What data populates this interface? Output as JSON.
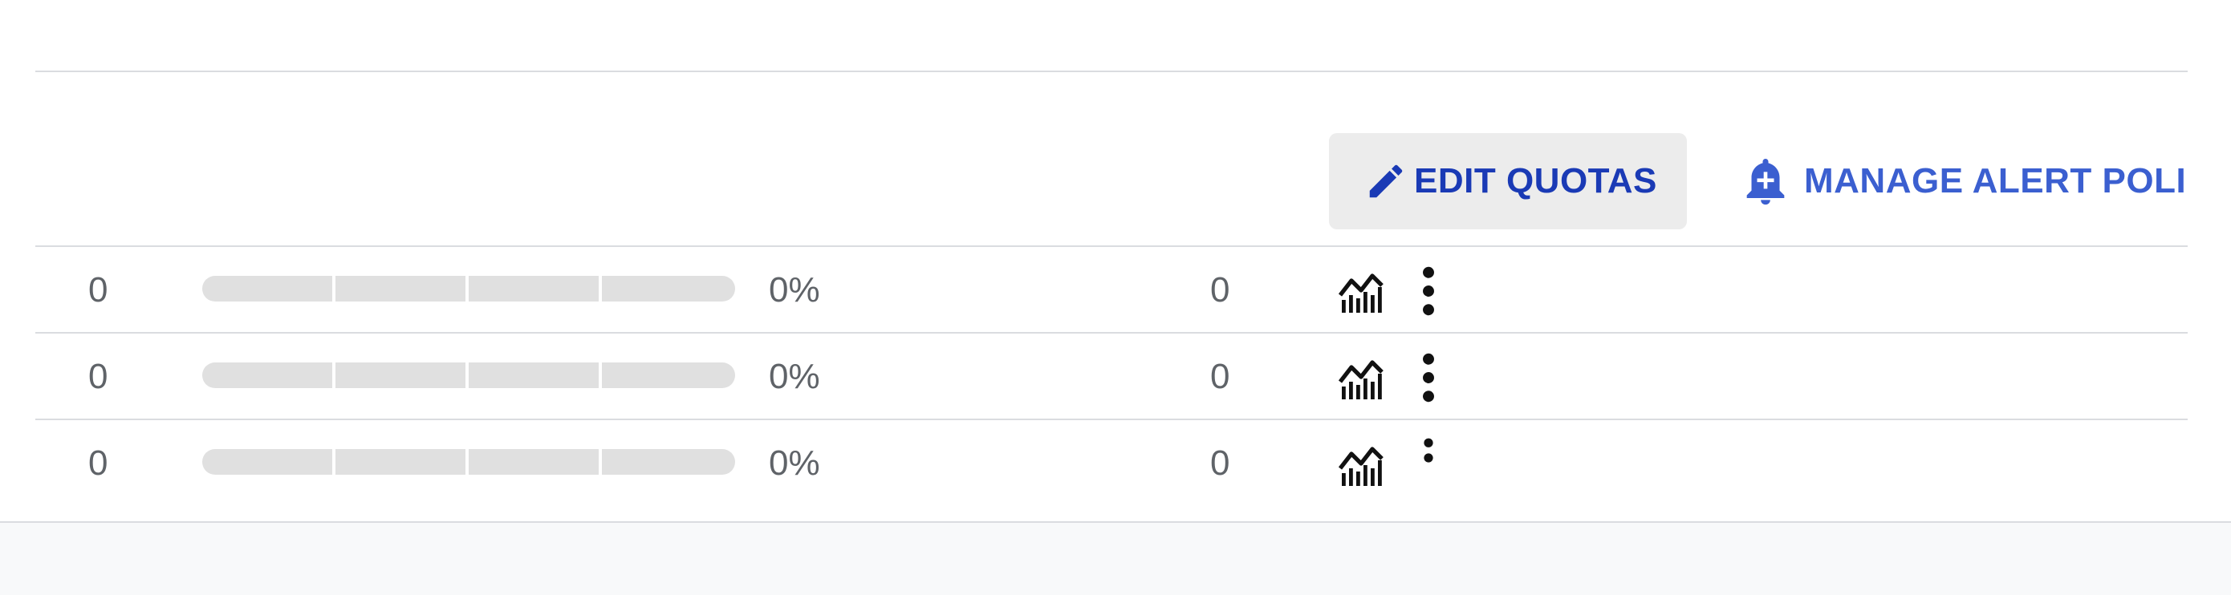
{
  "toolbar": {
    "edit_quotas": {
      "label": "EDIT QUOTAS",
      "icon": "pencil-icon"
    },
    "manage_alert_policies": {
      "label": "MANAGE ALERT POLIC",
      "icon": "bell-plus-icon"
    }
  },
  "rows": [
    {
      "value": "0",
      "usage_fraction": 0,
      "usage_percent": "0%",
      "current": "0",
      "chart_icon": "chart-icon",
      "menu_icon": "more-vert-icon"
    },
    {
      "value": "0",
      "usage_fraction": 0,
      "usage_percent": "0%",
      "current": "0",
      "chart_icon": "chart-icon",
      "menu_icon": "more-vert-icon"
    },
    {
      "value": "0",
      "usage_fraction": 0,
      "usage_percent": "0%",
      "current": "0",
      "chart_icon": "chart-icon",
      "menu_icon": "more-vert-icon"
    }
  ],
  "colors": {
    "edit_button_text": "#1a3ab5",
    "edit_button_bg": "#ececec",
    "manage_button_text": "#3b5fd0",
    "bar_track": "#e0e0e0",
    "divider": "#dadce0",
    "footer_bg": "#f8f9fa"
  }
}
